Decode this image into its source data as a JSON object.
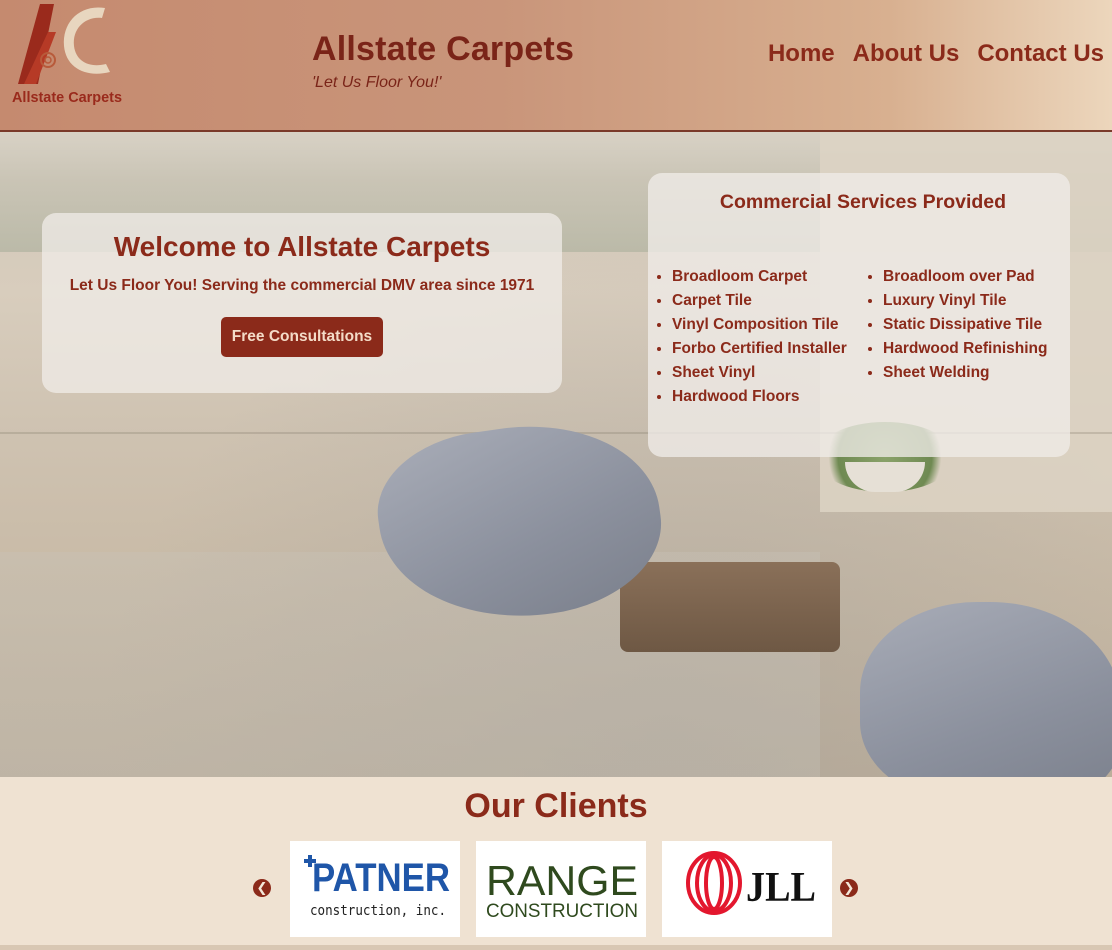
{
  "header": {
    "logo_text": "Allstate Carpets",
    "title": "Allstate Carpets",
    "tagline": "'Let Us Floor You!'",
    "nav": [
      {
        "label": "Home"
      },
      {
        "label": "About Us"
      },
      {
        "label": "Contact Us"
      }
    ]
  },
  "hero": {
    "welcome_title": "Welcome to Allstate Carpets",
    "welcome_subtitle": "Let Us Floor You! Serving the commercial DMV area since 1971",
    "cta_label": "Free Consultations",
    "services_title": "Commercial Services Provided",
    "services_left": [
      "Broadloom Carpet",
      "Carpet Tile",
      "Vinyl Composition Tile",
      "Forbo Certified Installer",
      "Sheet Vinyl",
      "Hardwood Floors"
    ],
    "services_right": [
      "Broadloom over Pad",
      "Luxury Vinyl Tile",
      "Static Dissipative Tile",
      "Hardwood Refinishing",
      "Sheet Welding"
    ]
  },
  "clients": {
    "title": "Our Clients",
    "prev_icon": "chevron-left-icon",
    "next_icon": "chevron-right-icon",
    "logos": [
      {
        "name": "PATNER",
        "sub": "construction, inc."
      },
      {
        "name": "RANGE",
        "sub": "CONSTRUCTION"
      },
      {
        "name": "JLL",
        "sub": ""
      }
    ]
  },
  "colors": {
    "brand": "#8b2a1a",
    "page_bg": "#efe2d2",
    "header_start": "#c58a6f",
    "header_end": "#ecd6bc"
  }
}
